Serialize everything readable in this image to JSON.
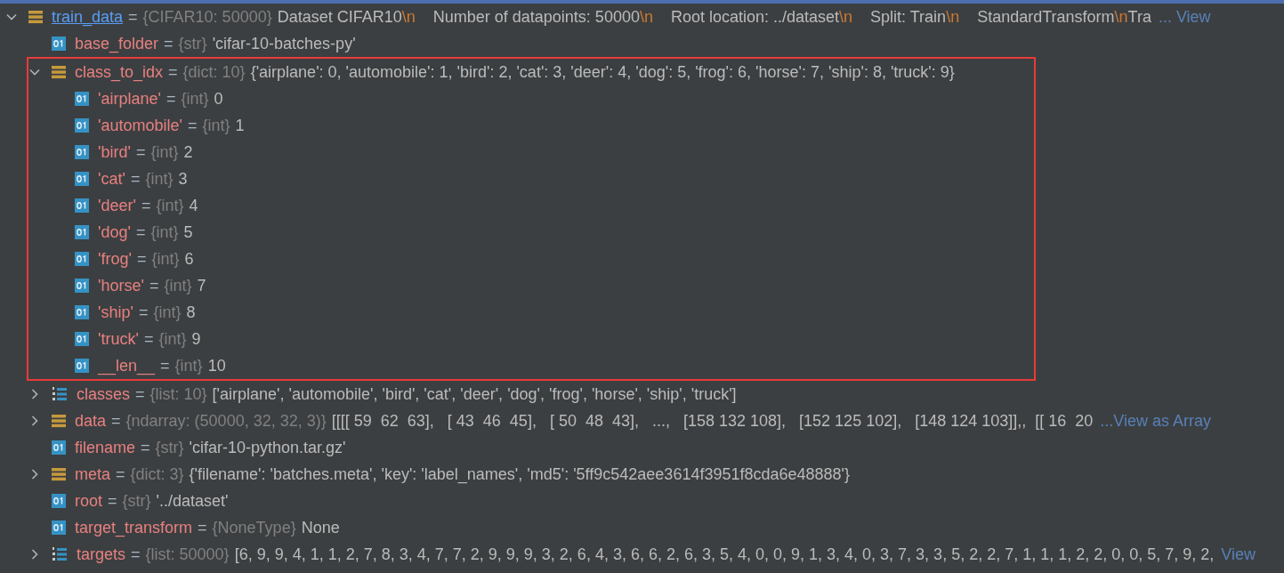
{
  "variables": [
    {
      "kind": "object",
      "name": "train_data",
      "eq": "=",
      "type": "{CIFAR10: 50000}",
      "expanded": true,
      "value_parts": [
        {
          "kind": "plain",
          "text": "Dataset CIFAR10"
        },
        {
          "kind": "escape",
          "text": "\\n"
        },
        {
          "kind": "plain",
          "text": "    Number of datapoints: 50000"
        },
        {
          "kind": "escape",
          "text": "\\n"
        },
        {
          "kind": "plain",
          "text": "    Root location: ../dataset"
        },
        {
          "kind": "escape",
          "text": "\\n"
        },
        {
          "kind": "plain",
          "text": "    Split: Train"
        },
        {
          "kind": "escape",
          "text": "\\n"
        },
        {
          "kind": "plain",
          "text": "    StandardTransform"
        },
        {
          "kind": "escape",
          "text": "\\n"
        },
        {
          "kind": "plain",
          "text": "Tra"
        }
      ],
      "link": "... View",
      "children": [
        {
          "kind": "scalar",
          "name": "base_folder",
          "eq": "=",
          "type": "{str}",
          "value": "'cifar-10-batches-py'"
        },
        {
          "kind": "dict",
          "name": "class_to_idx",
          "eq": "=",
          "type": "{dict: 10}",
          "value": "{'airplane': 0, 'automobile': 1, 'bird': 2, 'cat': 3, 'deer': 4, 'dog': 5, 'frog': 6, 'horse': 7, 'ship': 8, 'truck': 9}",
          "expanded": true,
          "highlighted": true,
          "children": [
            {
              "kind": "scalar",
              "name": "'airplane'",
              "eq": "=",
              "type": "{int}",
              "value": "0"
            },
            {
              "kind": "scalar",
              "name": "'automobile'",
              "eq": "=",
              "type": "{int}",
              "value": "1"
            },
            {
              "kind": "scalar",
              "name": "'bird'",
              "eq": "=",
              "type": "{int}",
              "value": "2"
            },
            {
              "kind": "scalar",
              "name": "'cat'",
              "eq": "=",
              "type": "{int}",
              "value": "3"
            },
            {
              "kind": "scalar",
              "name": "'deer'",
              "eq": "=",
              "type": "{int}",
              "value": "4"
            },
            {
              "kind": "scalar",
              "name": "'dog'",
              "eq": "=",
              "type": "{int}",
              "value": "5"
            },
            {
              "kind": "scalar",
              "name": "'frog'",
              "eq": "=",
              "type": "{int}",
              "value": "6"
            },
            {
              "kind": "scalar",
              "name": "'horse'",
              "eq": "=",
              "type": "{int}",
              "value": "7"
            },
            {
              "kind": "scalar",
              "name": "'ship'",
              "eq": "=",
              "type": "{int}",
              "value": "8"
            },
            {
              "kind": "scalar",
              "name": "'truck'",
              "eq": "=",
              "type": "{int}",
              "value": "9"
            },
            {
              "kind": "scalar",
              "name": "__len__",
              "eq": "=",
              "type": "{int}",
              "value": "10"
            }
          ]
        },
        {
          "kind": "list",
          "name": "classes",
          "eq": "=",
          "type": "{list: 10}",
          "value": "['airplane', 'automobile', 'bird', 'cat', 'deer', 'dog', 'frog', 'horse', 'ship', 'truck']",
          "expanded": false
        },
        {
          "kind": "dict",
          "name": "data",
          "eq": "=",
          "type": "{ndarray: (50000, 32, 32, 3)}",
          "value": "[[[[ 59  62  63],   [ 43  46  45],   [ 50  48  43],   ...,   [158 132 108],   [152 125 102],   [148 124 103]],,  [[ 16  20",
          "link": "...View as Array",
          "expanded": false
        },
        {
          "kind": "scalar",
          "name": "filename",
          "eq": "=",
          "type": "{str}",
          "value": "'cifar-10-python.tar.gz'"
        },
        {
          "kind": "dict",
          "name": "meta",
          "eq": "=",
          "type": "{dict: 3}",
          "value": "{'filename': 'batches.meta', 'key': 'label_names', 'md5': '5ff9c542aee3614f3951f8cda6e48888'}",
          "expanded": false
        },
        {
          "kind": "scalar",
          "name": "root",
          "eq": "=",
          "type": "{str}",
          "value": "'../dataset'"
        },
        {
          "kind": "scalar",
          "name": "target_transform",
          "eq": "=",
          "type": "{NoneType}",
          "value": "None"
        },
        {
          "kind": "list",
          "name": "targets",
          "eq": "=",
          "type": "{list: 50000}",
          "value": "[6, 9, 9, 4, 1, 1, 2, 7, 8, 3, 4, 7, 7, 2, 9, 9, 9, 3, 2, 6, 4, 3, 6, 6, 2, 6, 3, 5, 4, 0, 0, 9, 1, 3, 4, 0, 3, 7, 3, 3, 5, 2, 2, 7, 1, 1, 1, 2, 2, 0, 0, 5, 7, 9, 2,",
          "link": "View",
          "expanded": false
        }
      ]
    }
  ]
}
